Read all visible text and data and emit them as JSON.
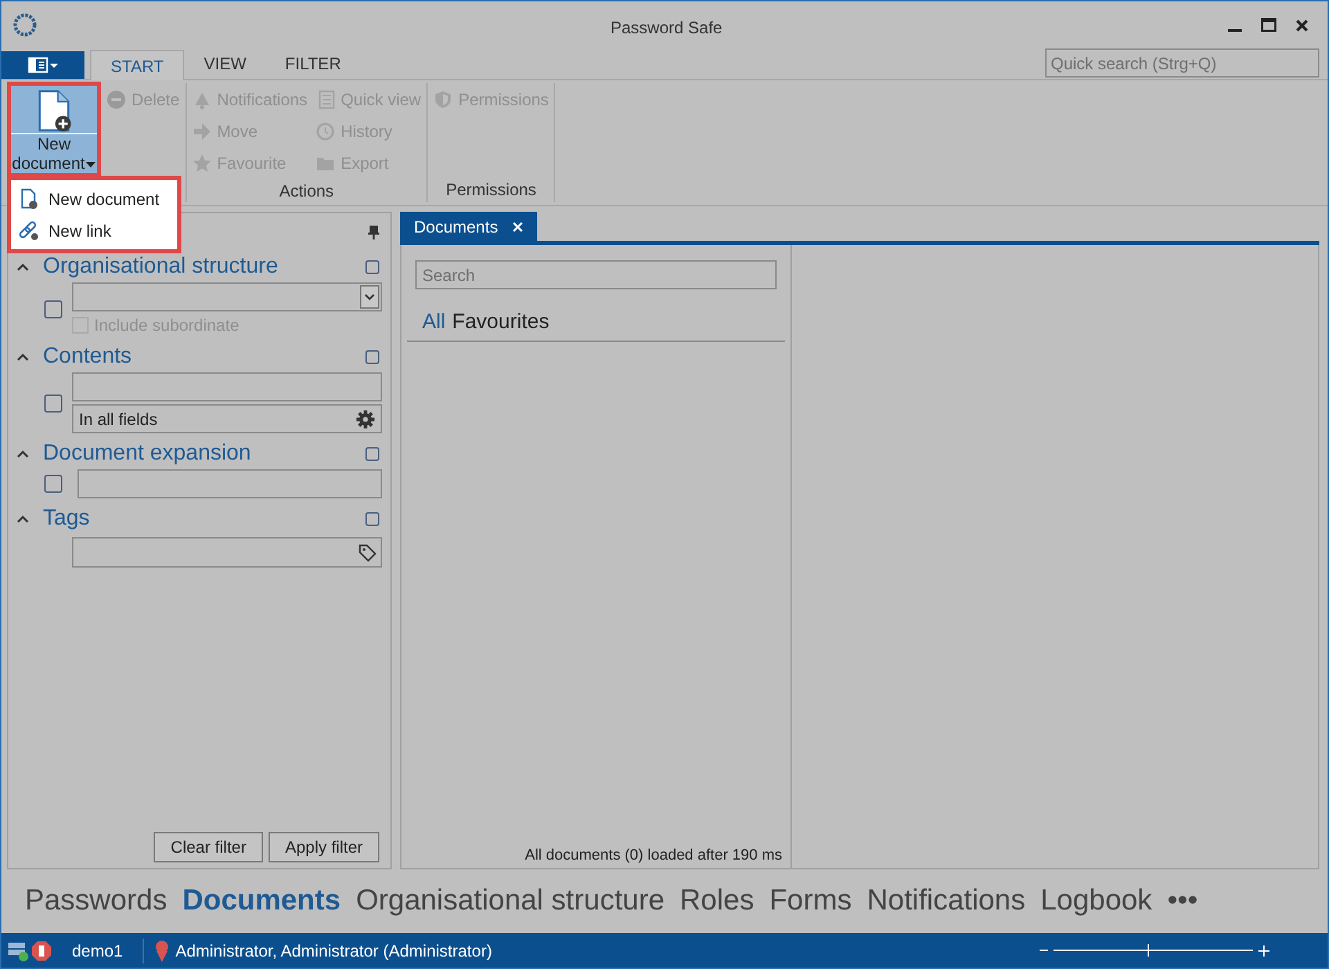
{
  "window": {
    "title": "Password Safe"
  },
  "ribbon_tabs": [
    {
      "label": "START",
      "selected": true
    },
    {
      "label": "VIEW",
      "selected": false
    },
    {
      "label": "FILTER",
      "selected": false
    }
  ],
  "quick_search": {
    "placeholder": "Quick search (Strg+Q)"
  },
  "new_document_button": {
    "label": "New document",
    "expanded": true
  },
  "ribbon_groups": [
    {
      "columns": [
        [
          {
            "label": "Delete",
            "disabled": true
          }
        ]
      ]
    },
    {
      "label": "Actions",
      "columns": [
        [
          {
            "label": "Notifications",
            "disabled": true
          },
          {
            "label": "Move",
            "disabled": true
          },
          {
            "label": "Favourite",
            "disabled": true
          }
        ],
        [
          {
            "label": "Quick view",
            "disabled": true
          },
          {
            "label": "History",
            "disabled": true
          },
          {
            "label": "Export",
            "disabled": true
          }
        ]
      ]
    },
    {
      "label": "Permissions",
      "columns": [
        [
          {
            "label": "Permissions",
            "disabled": true
          }
        ]
      ]
    }
  ],
  "dropdown_menu": [
    {
      "label": "New document"
    },
    {
      "label": "New link"
    }
  ],
  "filter_panel": {
    "sections": [
      {
        "kind": "dropdown",
        "title": "Organisational structure",
        "expanded": true,
        "checked": false,
        "option": {
          "label": "Include subordinate",
          "checked": false,
          "disabled": true
        }
      },
      {
        "kind": "text_mode",
        "title": "Contents",
        "expanded": true,
        "checked": false,
        "mode": "In all fields"
      },
      {
        "kind": "text",
        "title": "Document expansion",
        "expanded": true,
        "checked": false
      },
      {
        "kind": "tags",
        "title": "Tags",
        "expanded": true,
        "checked": false
      }
    ],
    "buttons": [
      "Clear filter",
      "Apply filter"
    ]
  },
  "document_tab": {
    "label": "Documents",
    "selected": true
  },
  "list": {
    "search_placeholder": "Search",
    "header_all": "All",
    "header_title": "Favourites",
    "status": "All documents (0) loaded after 190 ms"
  },
  "nav": [
    {
      "label": "Passwords",
      "selected": false
    },
    {
      "label": "Documents",
      "selected": true
    },
    {
      "label": "Organisational structure",
      "selected": false
    },
    {
      "label": "Roles",
      "selected": false
    },
    {
      "label": "Forms",
      "selected": false
    },
    {
      "label": "Notifications",
      "selected": false
    },
    {
      "label": "Logbook",
      "selected": false
    },
    {
      "label": "•••",
      "selected": false
    }
  ],
  "status_bar": {
    "database": "demo1",
    "user": "Administrator, Administrator (Administrator)",
    "zoom": {
      "level": 0.47
    }
  }
}
